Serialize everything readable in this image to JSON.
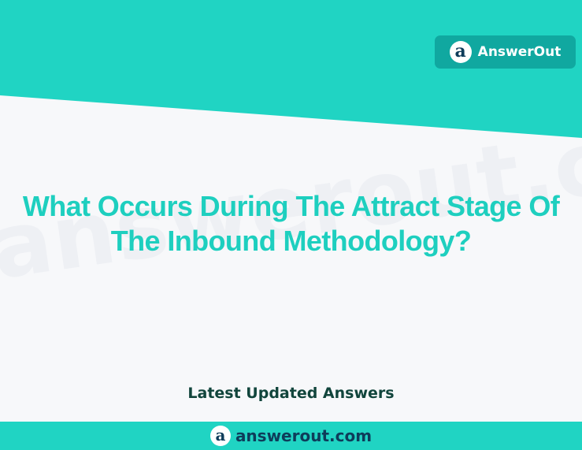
{
  "brand": {
    "logo_glyph": "a",
    "name": "AnswerOut",
    "icon": "answerout-logo-icon"
  },
  "watermark": {
    "text": "answerout.com"
  },
  "headline": {
    "line1": "What Occurs During The Attract Stage Of",
    "line2": "The Inbound Methodology?"
  },
  "subheading": "Latest Updated Answers",
  "footer": {
    "logo_glyph": "a",
    "url": "answerout.com",
    "icon": "answerout-logo-icon"
  },
  "colors": {
    "teal": "#20d4c3",
    "badge": "#10a8a0",
    "headline": "#1ecfbf",
    "dark": "#0e3c5a",
    "background": "#f7f8fa"
  }
}
